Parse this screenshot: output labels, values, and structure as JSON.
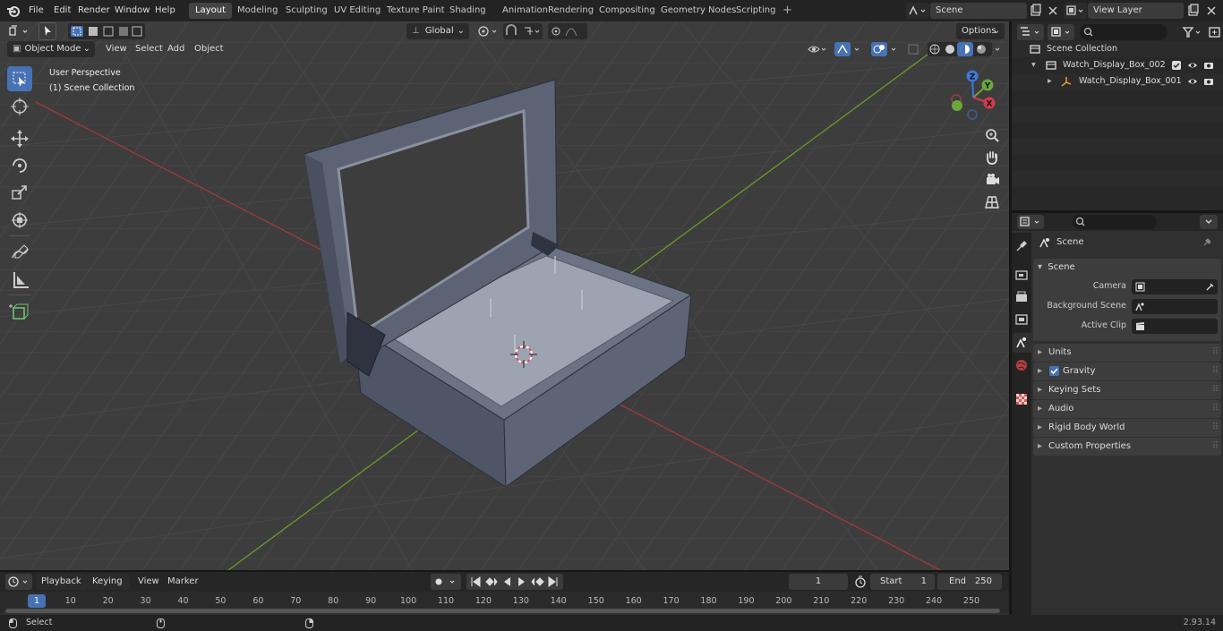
{
  "topbar": {
    "menus": [
      "File",
      "Edit",
      "Render",
      "Window",
      "Help"
    ],
    "workspaces": [
      "Layout",
      "Modeling",
      "Sculpting",
      "UV Editing",
      "Texture Paint",
      "Shading",
      "Animation",
      "Rendering",
      "Compositing",
      "Geometry Nodes",
      "Scripting"
    ],
    "active_workspace": "Layout",
    "add_tab": "+",
    "scene_name": "Scene",
    "view_layer": "View Layer"
  },
  "viewport": {
    "mode": "Object Mode",
    "menus": [
      "View",
      "Select",
      "Add",
      "Object"
    ],
    "transform_orientation": "Global",
    "options_label": "Options",
    "overlay_line1": "User Perspective",
    "overlay_line2": "(1) Scene Collection",
    "tools": [
      "select-box",
      "cursor",
      "move",
      "rotate",
      "scale",
      "transform",
      "annotate",
      "measure",
      "add-cube"
    ],
    "gizmo_axes": [
      "X",
      "Y",
      "Z"
    ]
  },
  "outliner": {
    "root": "Scene Collection",
    "items": [
      {
        "name": "Watch_Display_Box_002",
        "level": 1
      },
      {
        "name": "Watch_Display_Box_001",
        "level": 2
      }
    ]
  },
  "properties": {
    "context": "Scene",
    "panel_title": "Scene",
    "fields": [
      {
        "label": "Camera",
        "value": ""
      },
      {
        "label": "Background Scene",
        "value": ""
      },
      {
        "label": "Active Clip",
        "value": ""
      }
    ],
    "sections": [
      "Units",
      "Gravity",
      "Keying Sets",
      "Audio",
      "Rigid Body World",
      "Custom Properties"
    ],
    "gravity_checked": true
  },
  "timeline": {
    "menus": [
      "Playback",
      "Keying",
      "View",
      "Marker"
    ],
    "current_frame": "1",
    "start_label": "Start",
    "start": "1",
    "end_label": "End",
    "end": "250",
    "ticks": [
      "1",
      "10",
      "20",
      "30",
      "40",
      "50",
      "60",
      "70",
      "80",
      "90",
      "100",
      "110",
      "120",
      "130",
      "140",
      "150",
      "160",
      "170",
      "180",
      "190",
      "200",
      "210",
      "220",
      "230",
      "240",
      "250"
    ]
  },
  "status": {
    "left": "Select",
    "version": "2.93.14"
  }
}
